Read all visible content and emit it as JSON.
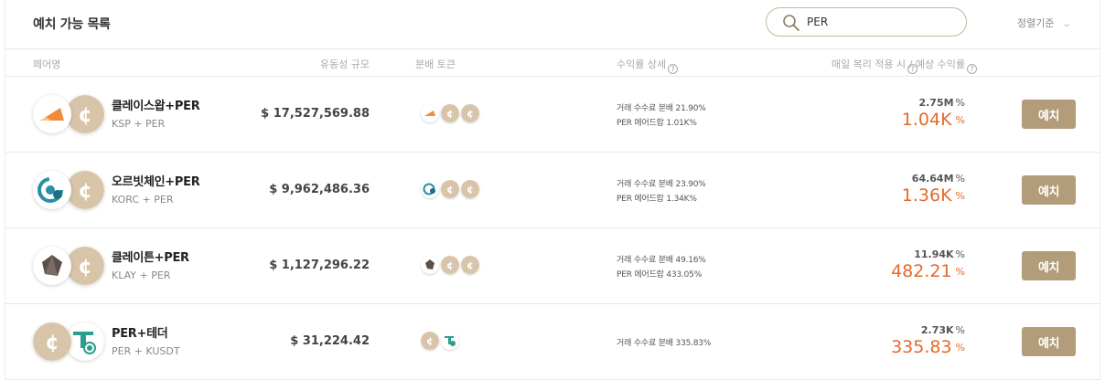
{
  "header": {
    "title": "예치 가능 목록",
    "search_value": "PER",
    "sort_label": "정렬기준"
  },
  "columns": {
    "pair": "페어명",
    "liquidity": "유동성 규모",
    "distribution": "분배 토큰",
    "apr_detail": "수익률 상세",
    "estimate": "매일 복리 적용 시",
    "estimate2": "/ 예상 수익률"
  },
  "icons": {
    "search": "search-icon",
    "sort": "chevron-down-icon",
    "help": "question-circle-icon"
  },
  "colors": {
    "accent": "#b39c7a",
    "per_token": "#d8c4a8",
    "yield": "#e46a2b",
    "ksp": "#f28a36",
    "korc": "#2a8fa5",
    "klay": "#5b4f48",
    "kusdt": "#2b9f8f"
  },
  "rows": [
    {
      "name": "클레이스왑+PER",
      "sub": "KSP + PER",
      "tokens": [
        "ksp",
        "per"
      ],
      "liquidity": "$ 17,527,569.88",
      "apr_lines": [
        "거래 수수료 분배 21.90%",
        "PER 에어드랍 1.01K%"
      ],
      "est_top": "2.75M",
      "est_big": "1.04K",
      "pct": "%",
      "button": "예치"
    },
    {
      "name": "오르빗체인+PER",
      "sub": "KORC + PER",
      "tokens": [
        "korc",
        "per"
      ],
      "liquidity": "$ 9,962,486.36",
      "apr_lines": [
        "거래 수수료 분배 23.90%",
        "PER 에어드랍 1.34K%"
      ],
      "est_top": "64.64M",
      "est_big": "1.36K",
      "pct": "%",
      "button": "예치"
    },
    {
      "name": "클레이튼+PER",
      "sub": "KLAY + PER",
      "tokens": [
        "klay",
        "per"
      ],
      "liquidity": "$ 1,127,296.22",
      "apr_lines": [
        "거래 수수료 분배 49.16%",
        "PER 에어드랍 433.05%"
      ],
      "est_top": "11.94K",
      "est_big": "482.21",
      "pct": "%",
      "button": "예치"
    },
    {
      "name": "PER+테더",
      "sub": "PER + KUSDT",
      "tokens": [
        "per",
        "kusdt"
      ],
      "liquidity": "$ 31,224.42",
      "apr_lines": [
        "거래 수수료 분배 335.83%"
      ],
      "est_top": "2.73K",
      "est_big": "335.83",
      "pct": "%",
      "button": "예치"
    }
  ]
}
